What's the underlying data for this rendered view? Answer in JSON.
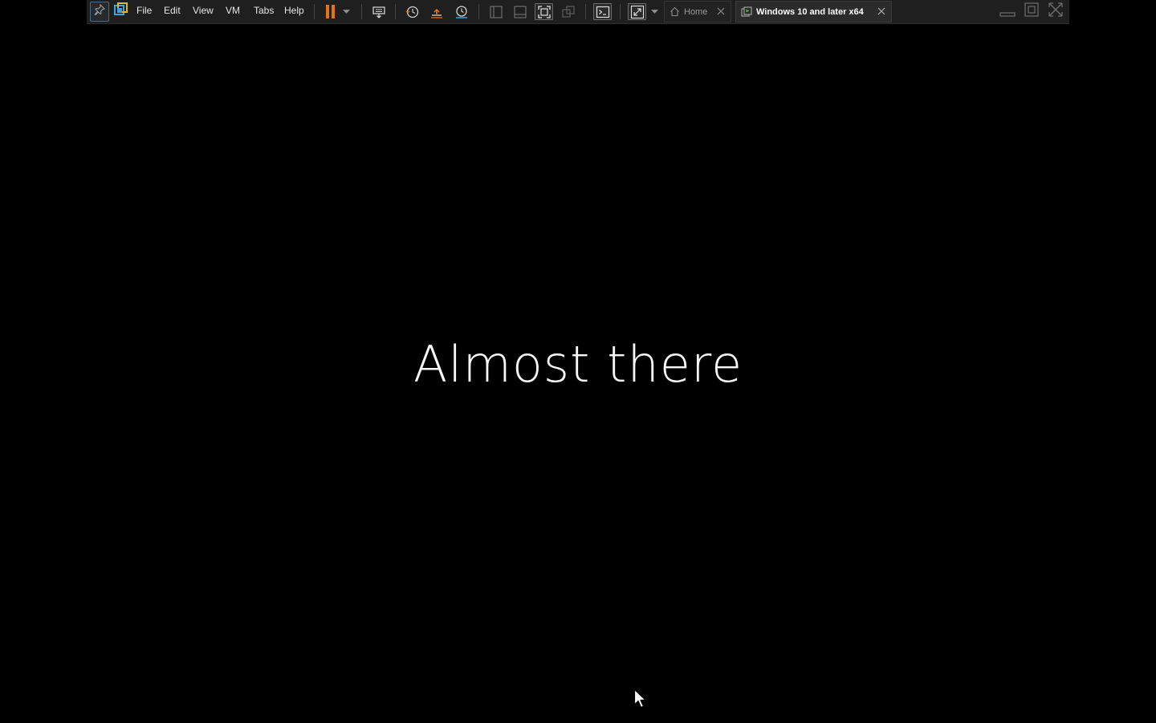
{
  "toolbar": {
    "menu": {
      "file": "File",
      "edit": "Edit",
      "view": "View",
      "vm": "VM",
      "tabs": "Tabs",
      "help": "Help"
    },
    "tabs": [
      {
        "label": "Home",
        "icon": "home-icon",
        "active": false
      },
      {
        "label": "Windows 10 and later x64",
        "icon": "vm-icon",
        "active": true
      }
    ],
    "icons": [
      "pin-icon",
      "vmware-logo-icon",
      "pause-icon",
      "chevron-down-icon",
      "send-ctrl-alt-del-icon",
      "snapshot-take-icon",
      "snapshot-revert-icon",
      "snapshot-manager-icon",
      "library-panel-icon",
      "thumbnail-bar-icon",
      "full-screen-icon",
      "unity-icon",
      "console-icon",
      "stretch-guest-icon",
      "minimize-icon",
      "restore-icon",
      "close-icon"
    ],
    "colors": {
      "accent": "#e8720c",
      "background": "#1f1f1f",
      "text": "#e6e6e6"
    }
  },
  "guest": {
    "message": "Almost there",
    "background": "#000000"
  }
}
